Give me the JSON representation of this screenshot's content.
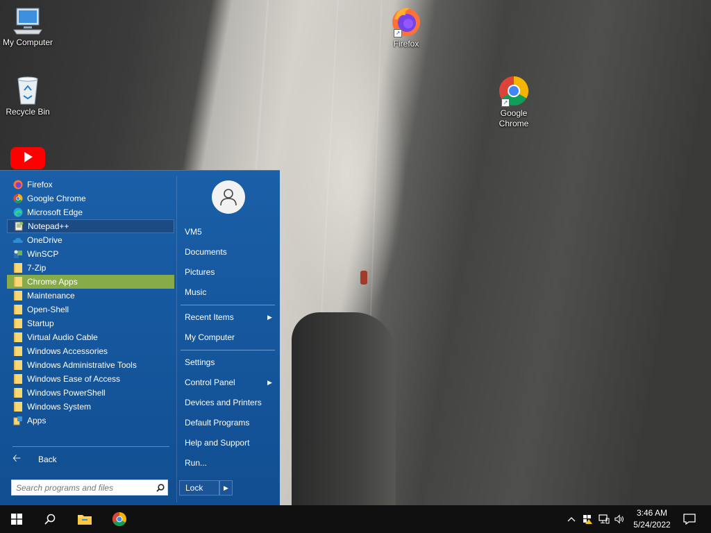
{
  "desktop": {
    "icons": [
      {
        "label": "My Computer",
        "icon": "computer-icon"
      },
      {
        "label": "Recycle Bin",
        "icon": "recycle-bin-icon"
      },
      {
        "label": "Firefox",
        "icon": "firefox-icon"
      },
      {
        "label": "Google Chrome",
        "icon": "chrome-icon"
      },
      {
        "label": "",
        "icon": "youtube-icon"
      }
    ]
  },
  "start_menu": {
    "programs": [
      {
        "label": "Firefox",
        "icon": "firefox-icon"
      },
      {
        "label": "Google Chrome",
        "icon": "chrome-icon"
      },
      {
        "label": "Microsoft Edge",
        "icon": "edge-icon"
      },
      {
        "label": "Notepad++",
        "icon": "notepad-plus-plus-icon",
        "state": "selected"
      },
      {
        "label": "OneDrive",
        "icon": "onedrive-icon"
      },
      {
        "label": "WinSCP",
        "icon": "winscp-icon"
      },
      {
        "label": "7-Zip",
        "icon": "folder-icon"
      },
      {
        "label": "Chrome Apps",
        "icon": "folder-icon",
        "state": "hover"
      },
      {
        "label": "Maintenance",
        "icon": "folder-icon"
      },
      {
        "label": "Open-Shell",
        "icon": "folder-icon"
      },
      {
        "label": "Startup",
        "icon": "folder-icon"
      },
      {
        "label": "Virtual Audio Cable",
        "icon": "folder-icon"
      },
      {
        "label": "Windows Accessories",
        "icon": "folder-icon"
      },
      {
        "label": "Windows Administrative Tools",
        "icon": "folder-icon"
      },
      {
        "label": "Windows Ease of Access",
        "icon": "folder-icon"
      },
      {
        "label": "Windows PowerShell",
        "icon": "folder-icon"
      },
      {
        "label": "Windows System",
        "icon": "folder-icon"
      },
      {
        "label": "Apps",
        "icon": "apps-icon"
      }
    ],
    "back_label": "Back",
    "search_placeholder": "Search programs and files",
    "user": {
      "icon": "user-avatar-icon"
    },
    "places": {
      "vm5": "VM5",
      "documents": "Documents",
      "pictures": "Pictures",
      "music": "Music",
      "recent_items": "Recent Items",
      "my_computer": "My Computer",
      "settings": "Settings",
      "control_panel": "Control Panel",
      "devices_printers": "Devices and Printers",
      "default_programs": "Default Programs",
      "help_support": "Help and Support",
      "run": "Run..."
    },
    "lock_label": "Lock"
  },
  "taskbar": {
    "time": "3:46 AM",
    "date": "5/24/2022",
    "pinned": [
      "windows-start-icon",
      "search-icon",
      "file-explorer-icon",
      "chrome-icon"
    ],
    "tray": [
      "chevron-up-icon",
      "network-warning-icon",
      "network-icon",
      "volume-icon",
      "notifications-icon"
    ]
  },
  "colors": {
    "menu_bg": "#1a5fa8",
    "hover_green": "#88ab4a",
    "taskbar": "#101010"
  }
}
